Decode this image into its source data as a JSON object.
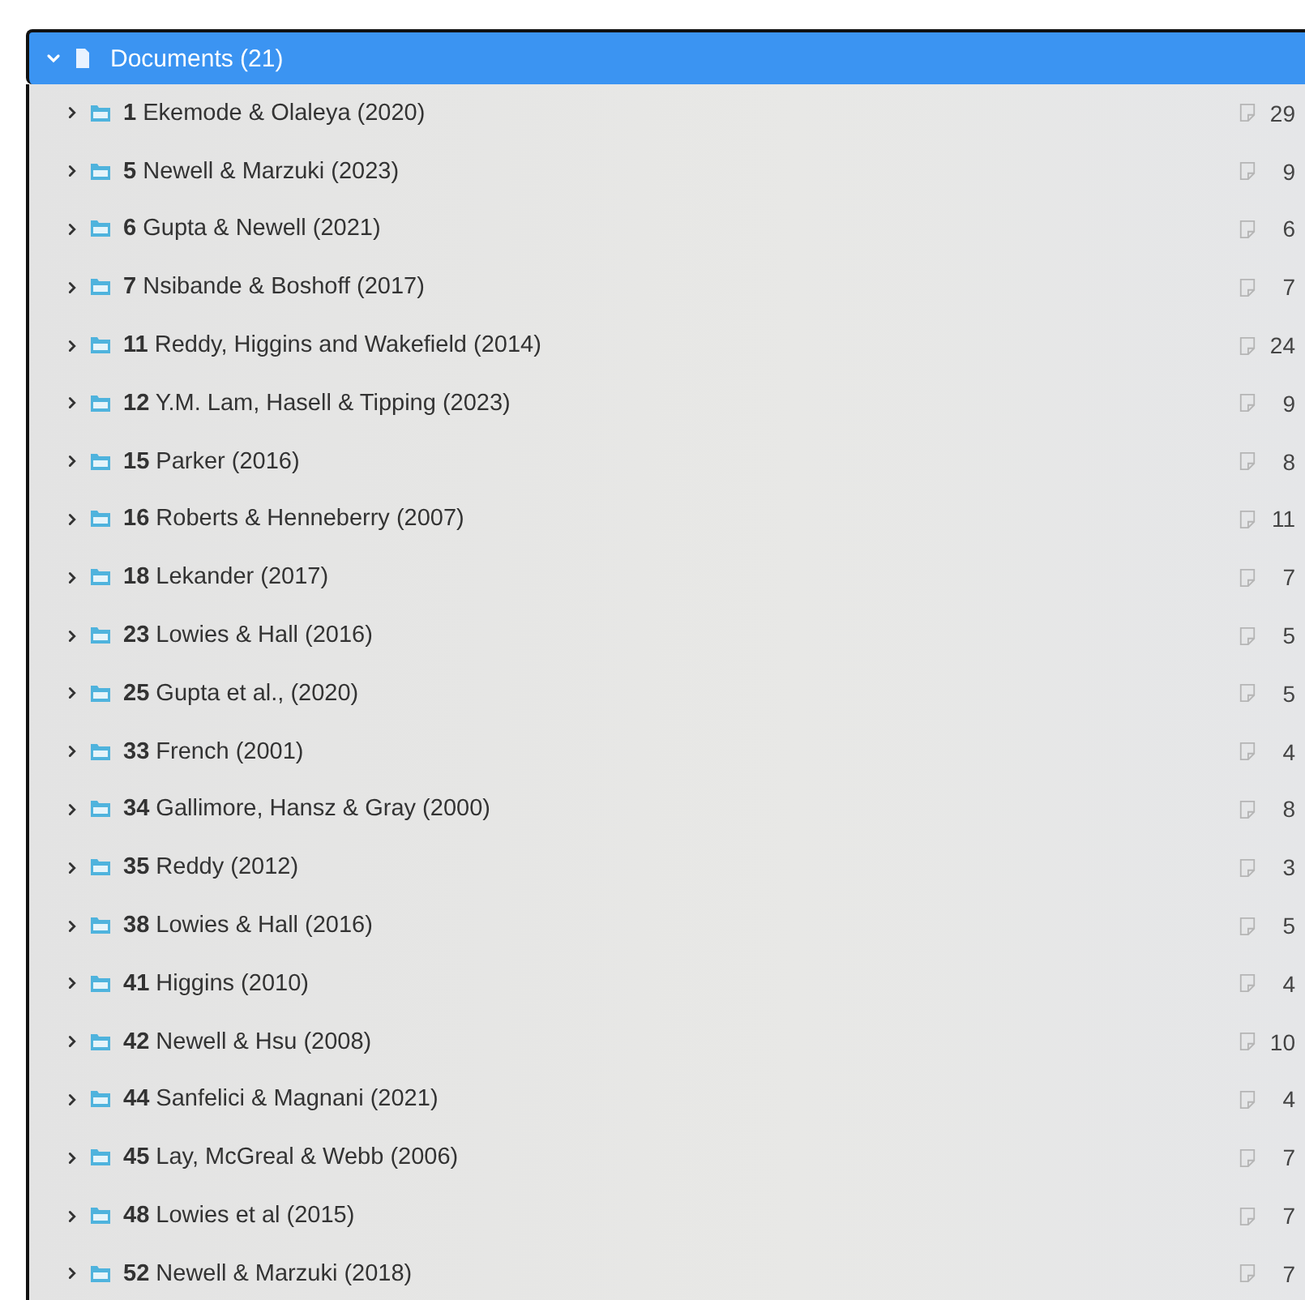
{
  "folder": {
    "label": "Documents (21)",
    "expanded": true,
    "selected": true
  },
  "documents": [
    {
      "number": "1",
      "title": "Ekemode & Olaleya (2020)",
      "count": "29"
    },
    {
      "number": "5",
      "title": "Newell & Marzuki (2023)",
      "count": "9"
    },
    {
      "number": "6",
      "title": "Gupta & Newell (2021)",
      "count": "6"
    },
    {
      "number": "7",
      "title": "Nsibande & Boshoff (2017)",
      "count": "7"
    },
    {
      "number": "11",
      "title": "Reddy, Higgins and Wakefield (2014)",
      "count": "24"
    },
    {
      "number": "12",
      "title": "Y.M. Lam, Hasell & Tipping (2023)",
      "count": "9"
    },
    {
      "number": "15",
      "title": "Parker (2016)",
      "count": "8"
    },
    {
      "number": "16",
      "title": "Roberts & Henneberry (2007)",
      "count": "11"
    },
    {
      "number": "18",
      "title": "Lekander (2017)",
      "count": "7"
    },
    {
      "number": "23",
      "title": "Lowies & Hall (2016)",
      "count": "5"
    },
    {
      "number": "25",
      "title": "Gupta et al., (2020)",
      "count": "5"
    },
    {
      "number": "33",
      "title": "French (2001)",
      "count": "4"
    },
    {
      "number": "34",
      "title": "Gallimore, Hansz & Gray (2000)",
      "count": "8"
    },
    {
      "number": "35",
      "title": "Reddy (2012)",
      "count": "3"
    },
    {
      "number": "38",
      "title": "Lowies  & Hall (2016)",
      "count": "5"
    },
    {
      "number": "41",
      "title": "Higgins (2010)",
      "count": "4"
    },
    {
      "number": "42",
      "title": "Newell & Hsu (2008)",
      "count": "10"
    },
    {
      "number": "44",
      "title": "Sanfelici & Magnani (2021)",
      "count": "4"
    },
    {
      "number": "45",
      "title": "Lay, McGreal & Webb (2006)",
      "count": "7"
    },
    {
      "number": "48",
      "title": "Lowies et al (2015)",
      "count": "7"
    },
    {
      "number": "52",
      "title": "Newell & Marzuki (2018)",
      "count": "7"
    }
  ]
}
